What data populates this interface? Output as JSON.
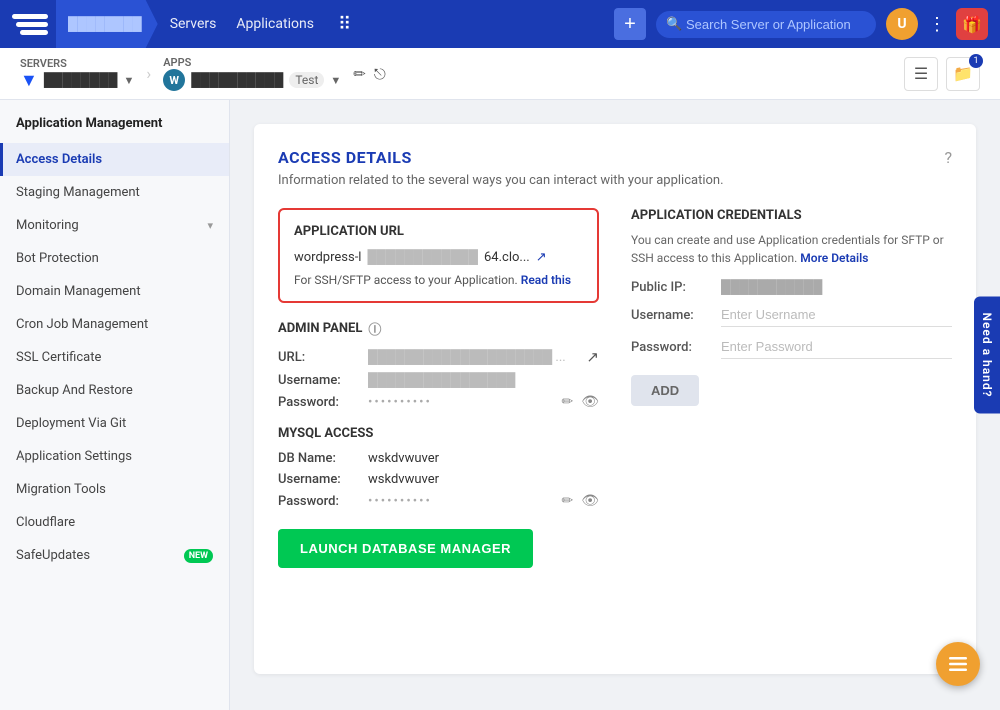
{
  "nav": {
    "logo_alt": "Cloudways Logo",
    "breadcrumb": "server-name",
    "servers_label": "Servers",
    "applications_label": "Applications",
    "plus_label": "+",
    "search_placeholder": "Search Server or Application",
    "avatar_initial": "U",
    "gift_icon": "🎁"
  },
  "subheader": {
    "servers_section": "Servers",
    "server_name": "Server Name",
    "apps_section": "Apps",
    "app_name": "appname",
    "app_tag": "Test",
    "edit_icon": "✏",
    "external_icon": "⎋",
    "list_icon": "☰",
    "folder_icon": "📁",
    "folder_badge": "1"
  },
  "sidebar": {
    "title": "Application Management",
    "items": [
      {
        "id": "access-details",
        "label": "Access Details",
        "active": true
      },
      {
        "id": "staging-management",
        "label": "Staging Management",
        "active": false
      },
      {
        "id": "monitoring",
        "label": "Monitoring",
        "active": false,
        "has_caret": true
      },
      {
        "id": "bot-protection",
        "label": "Bot Protection",
        "active": false
      },
      {
        "id": "domain-management",
        "label": "Domain Management",
        "active": false
      },
      {
        "id": "cron-job-management",
        "label": "Cron Job Management",
        "active": false
      },
      {
        "id": "ssl-certificate",
        "label": "SSL Certificate",
        "active": false
      },
      {
        "id": "backup-and-restore",
        "label": "Backup And Restore",
        "active": false
      },
      {
        "id": "deployment-via-git",
        "label": "Deployment Via Git",
        "active": false
      },
      {
        "id": "application-settings",
        "label": "Application Settings",
        "active": false
      },
      {
        "id": "migration-tools",
        "label": "Migration Tools",
        "active": false
      },
      {
        "id": "cloudflare",
        "label": "Cloudflare",
        "active": false
      },
      {
        "id": "safeupdates",
        "label": "SafeUpdates",
        "active": false,
        "badge": "NEW"
      }
    ]
  },
  "main": {
    "title": "ACCESS DETAILS",
    "subtitle": "Information related to the several ways you can interact with your application.",
    "help_icon": "?",
    "app_url": {
      "section_title": "APPLICATION URL",
      "url_text": "wordpress-l",
      "url_suffix": "64.clo...",
      "external_icon": "↗",
      "ssh_note": "For SSH/SFTP access to your Application.",
      "read_this": "Read this"
    },
    "admin_panel": {
      "section_title": "ADMIN PANEL",
      "info_icon": "ⓘ",
      "url_label": "URL:",
      "url_value": "admin url here ...",
      "username_label": "Username:",
      "username_value": "admin_username",
      "password_label": "Password:",
      "password_dots": "••••••••••",
      "edit_icon": "✏",
      "eye_icon": "👁"
    },
    "mysql_access": {
      "section_title": "MYSQL ACCESS",
      "db_name_label": "DB Name:",
      "db_name_value": "wskdvwuver",
      "username_label": "Username:",
      "username_value": "wskdvwuver",
      "password_label": "Password:",
      "password_dots": "••••••••••",
      "edit_icon": "✏",
      "eye_icon": "👁"
    },
    "launch_btn": "LAUNCH DATABASE MANAGER",
    "credentials": {
      "section_title": "APPLICATION CREDENTIALS",
      "description": "You can create and use Application credentials for SFTP or SSH access to this Application.",
      "more_details": "More Details",
      "public_ip_label": "Public IP:",
      "public_ip_value": "xxx.xxx.xxx.xxx",
      "username_label": "Username:",
      "username_placeholder": "Enter Username",
      "password_label": "Password:",
      "password_placeholder": "Enter Password",
      "add_btn": "ADD"
    }
  },
  "need_hand": "Need a hand?",
  "fab_icon": "⠿"
}
